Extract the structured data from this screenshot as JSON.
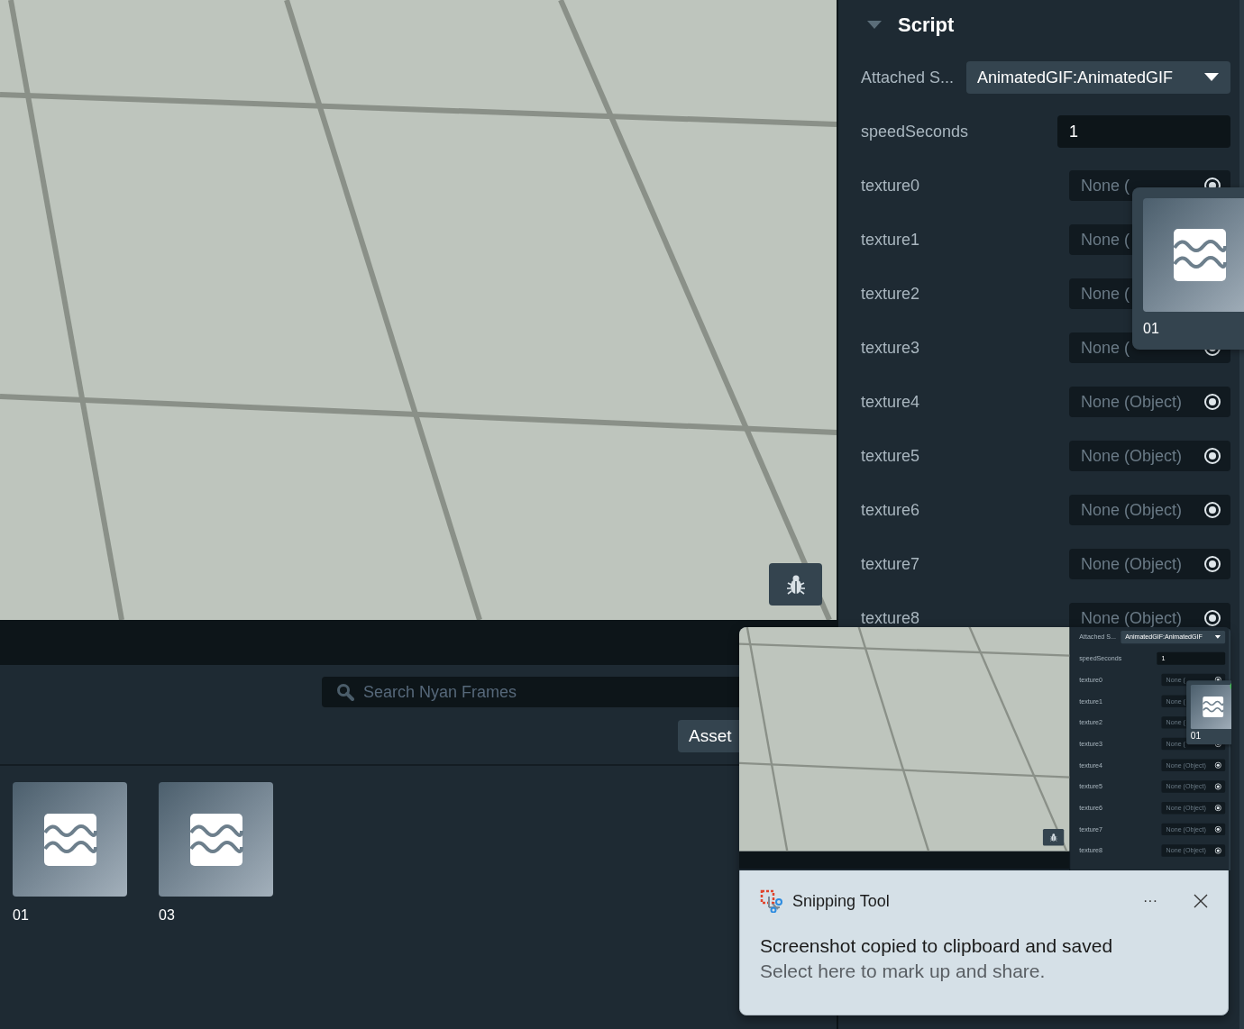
{
  "editor": {
    "inspector": {
      "title": "Script",
      "rows": [
        {
          "kind": "dropdown",
          "label": "Attached S...",
          "value": "AnimatedGIF:AnimatedGIF"
        },
        {
          "kind": "number",
          "label": "speedSeconds",
          "value": "1"
        },
        {
          "kind": "object",
          "label": "texture0",
          "value": "None ("
        },
        {
          "kind": "covered",
          "label": "texture1",
          "value": "None ("
        },
        {
          "kind": "covered",
          "label": "texture2",
          "value": "None ("
        },
        {
          "kind": "object",
          "label": "texture3",
          "value": "None ("
        },
        {
          "kind": "object",
          "label": "texture4",
          "value": "None (Object)"
        },
        {
          "kind": "object",
          "label": "texture5",
          "value": "None (Object)"
        },
        {
          "kind": "object",
          "label": "texture6",
          "value": "None (Object)"
        },
        {
          "kind": "object",
          "label": "texture7",
          "value": "None (Object)"
        },
        {
          "kind": "object",
          "label": "texture8",
          "value": "None (Object)"
        }
      ]
    },
    "drag_preview": {
      "label": "01",
      "accepted": false
    },
    "bottom_panel": {
      "search": {
        "placeholder": "Search Nyan Frames"
      },
      "button": "Asset",
      "assets": [
        {
          "label": "01"
        },
        {
          "label": "03"
        }
      ]
    }
  },
  "notification": {
    "screenshot": {
      "inspector": {
        "rows": [
          {
            "kind": "dropdown",
            "label": "Attached S...",
            "value": "AnimatedGIF:AnimatedGIF"
          },
          {
            "kind": "number",
            "label": "speedSeconds",
            "value": "1"
          },
          {
            "kind": "object",
            "label": "texture0",
            "value": "None ("
          },
          {
            "kind": "covered",
            "label": "texture1",
            "value": "None ("
          },
          {
            "kind": "covered",
            "label": "texture2",
            "value": "None ("
          },
          {
            "kind": "object",
            "label": "texture3",
            "value": "None ("
          },
          {
            "kind": "object",
            "label": "texture4",
            "value": "None (Object)"
          },
          {
            "kind": "object",
            "label": "texture5",
            "value": "None (Object)"
          },
          {
            "kind": "object",
            "label": "texture6",
            "value": "None (Object)"
          },
          {
            "kind": "object",
            "label": "texture7",
            "value": "None (Object)"
          },
          {
            "kind": "object",
            "label": "texture8",
            "value": "None (Object)"
          }
        ]
      },
      "drag_preview": {
        "label": "01",
        "accepted": true
      }
    },
    "app": "Snipping Tool",
    "more": "···",
    "title": "Screenshot copied to clipboard and saved",
    "message": "Select here to mark up and share."
  }
}
